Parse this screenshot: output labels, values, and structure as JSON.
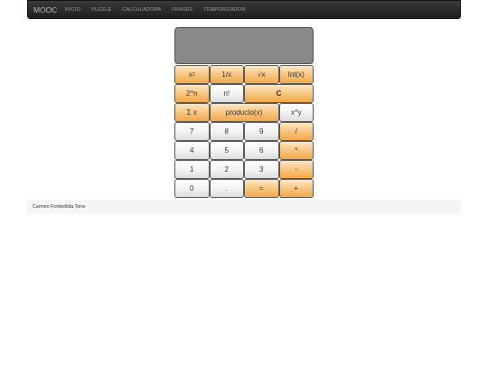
{
  "navbar": {
    "brand": "MOOC",
    "links": [
      "INICIO",
      "PUZZLE",
      "CALCULADORA",
      "FRASES",
      "TEMPORIZADOR"
    ]
  },
  "calculator": {
    "display": "",
    "rows": [
      [
        {
          "label": "x",
          "sup": "2",
          "style": "orange",
          "name": "square-button"
        },
        {
          "label": "1/x",
          "style": "orange",
          "name": "inverse-button"
        },
        {
          "label": "√x",
          "style": "orange",
          "name": "sqrt-button"
        },
        {
          "label": "Int(x)",
          "style": "orange",
          "name": "int-button"
        }
      ],
      [
        {
          "label": "2^n",
          "style": "orange",
          "name": "power-of-two-button"
        },
        {
          "label": "n!",
          "style": "light",
          "name": "factorial-button"
        },
        {
          "label": "C",
          "style": "orange",
          "wide": true,
          "bold": true,
          "name": "clear-button"
        }
      ],
      [
        {
          "label": "Σ x",
          "style": "orange",
          "name": "sum-button"
        },
        {
          "label": "producto(x)",
          "style": "orange",
          "wide": true,
          "name": "product-button"
        },
        {
          "label": "x^y",
          "style": "light",
          "name": "power-button"
        }
      ],
      [
        {
          "label": "7",
          "style": "light",
          "name": "digit-7-button"
        },
        {
          "label": "8",
          "style": "light",
          "name": "digit-8-button"
        },
        {
          "label": "9",
          "style": "light",
          "name": "digit-9-button"
        },
        {
          "label": "/",
          "style": "orange",
          "name": "divide-button"
        }
      ],
      [
        {
          "label": "4",
          "style": "light",
          "name": "digit-4-button"
        },
        {
          "label": "5",
          "style": "light",
          "name": "digit-5-button"
        },
        {
          "label": "6",
          "style": "light",
          "name": "digit-6-button"
        },
        {
          "label": "*",
          "style": "orange",
          "name": "multiply-button"
        }
      ],
      [
        {
          "label": "1",
          "style": "light",
          "name": "digit-1-button"
        },
        {
          "label": "2",
          "style": "light",
          "name": "digit-2-button"
        },
        {
          "label": "3",
          "style": "light",
          "name": "digit-3-button"
        },
        {
          "label": "-",
          "style": "orange",
          "name": "subtract-button"
        }
      ],
      [
        {
          "label": "0",
          "style": "light",
          "name": "digit-0-button"
        },
        {
          "label": ".",
          "style": "light",
          "name": "decimal-button"
        },
        {
          "label": "=",
          "style": "orange",
          "name": "equals-button"
        },
        {
          "label": "+",
          "style": "orange",
          "name": "add-button"
        }
      ]
    ]
  },
  "footer": {
    "author": "Carmen Fombellida Torre"
  },
  "colors": {
    "navbar": "#2a2a2a",
    "orange_key": "#f8c27a",
    "light_key": "#f2f2f2"
  }
}
